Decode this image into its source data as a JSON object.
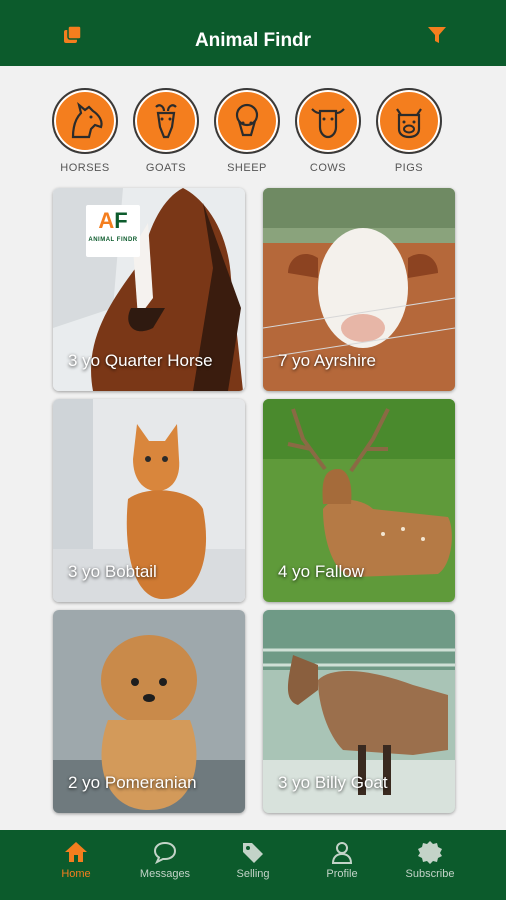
{
  "app": {
    "title": "Animal Findr"
  },
  "colors": {
    "header_green": "#0c5b2c",
    "accent_orange": "#f47e1e",
    "background": "#f1f1f1"
  },
  "categories": [
    {
      "label": "HORSES",
      "icon": "horse-icon"
    },
    {
      "label": "GOATS",
      "icon": "goat-icon"
    },
    {
      "label": "SHEEP",
      "icon": "sheep-icon"
    },
    {
      "label": "COWS",
      "icon": "cow-icon"
    },
    {
      "label": "PIGS",
      "icon": "pig-icon"
    }
  ],
  "listings": [
    {
      "caption": "3 yo Quarter Horse",
      "image": "horse-photo"
    },
    {
      "caption": "7 yo Ayrshire",
      "image": "cow-photo"
    },
    {
      "caption": "3 yo Bobtail",
      "image": "cat-photo"
    },
    {
      "caption": "4 yo Fallow",
      "image": "deer-photo"
    },
    {
      "caption": "2 yo Pomeranian",
      "image": "dog-photo"
    },
    {
      "caption": "3 yo Billy Goat",
      "image": "goat-photo"
    }
  ],
  "logo": {
    "big": "AF",
    "small": "ANIMAL FINDR"
  },
  "nav": [
    {
      "label": "Home",
      "icon": "home-icon",
      "active": true
    },
    {
      "label": "Messages",
      "icon": "chat-bubble-icon",
      "active": false
    },
    {
      "label": "Selling",
      "icon": "tag-icon",
      "active": false
    },
    {
      "label": "Profile",
      "icon": "person-icon",
      "active": false
    },
    {
      "label": "Subscribe",
      "icon": "badge-icon",
      "active": false
    }
  ]
}
